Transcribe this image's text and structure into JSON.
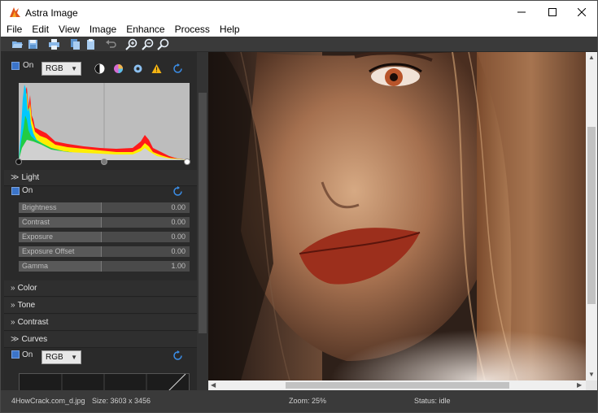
{
  "window": {
    "title": "Astra Image"
  },
  "menu": [
    "File",
    "Edit",
    "View",
    "Image",
    "Enhance",
    "Process",
    "Help"
  ],
  "toolbar": {
    "icons": [
      "open-icon",
      "save-icon",
      "print-icon",
      "copy-icon",
      "paste-icon",
      "undo-icon",
      "zoom-in-icon",
      "zoom-out-icon",
      "zoom-fit-icon"
    ]
  },
  "levels": {
    "on_label": "On",
    "channel": "RGB"
  },
  "light": {
    "title": "Light",
    "on_label": "On",
    "sliders": [
      {
        "label": "Brightness",
        "value": "0.00",
        "level": 0.5
      },
      {
        "label": "Contrast",
        "value": "0.00",
        "level": 0.5
      },
      {
        "label": "Exposure",
        "value": "0.00",
        "level": 0.5
      },
      {
        "label": "Exposure Offset",
        "value": "0.00",
        "level": 0.5
      },
      {
        "label": "Gamma",
        "value": "1.00",
        "level": 0.5
      }
    ]
  },
  "sections": {
    "color": "Color",
    "tone": "Tone",
    "contrast": "Contrast",
    "curves": "Curves"
  },
  "curves": {
    "on_label": "On",
    "channel": "RGB"
  },
  "status": {
    "filename": "4HowCrack.com_d.jpg",
    "size": "Size: 3603 x 3456",
    "zoom": "Zoom: 25%",
    "state": "Status: idle"
  },
  "colors": {
    "accent": "#3b74c9",
    "panel": "#2d2d2d",
    "warning": "#f3b313"
  }
}
